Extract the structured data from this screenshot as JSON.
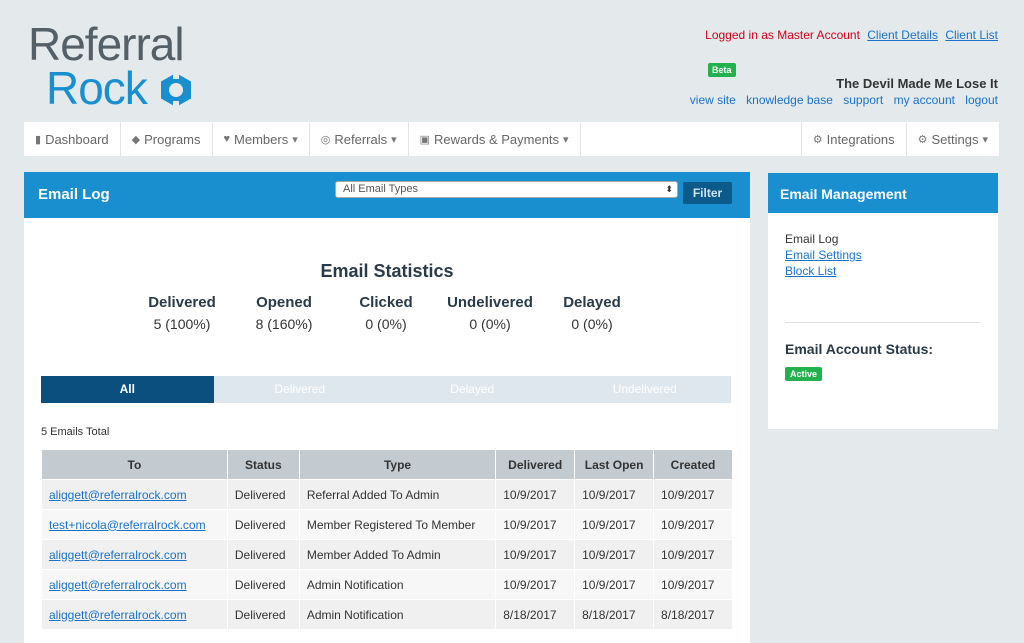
{
  "logo": {
    "line1": "Referral",
    "line2": "Rock"
  },
  "header": {
    "logged_in_text": "Logged in as Master Account",
    "client_details": "Client Details",
    "client_list": "Client List",
    "beta_badge": "Beta",
    "account_name": "The Devil Made Me Lose It",
    "links": [
      "view site",
      "knowledge base",
      "support",
      "my account",
      "logout"
    ]
  },
  "nav": {
    "dashboard": "Dashboard",
    "programs": "Programs",
    "members": "Members",
    "referrals": "Referrals",
    "rewards": "Rewards & Payments",
    "integrations": "Integrations",
    "settings": "Settings"
  },
  "email_log": {
    "title": "Email Log",
    "select_value": "All Email Types",
    "filter_label": "Filter",
    "stats_title": "Email Statistics",
    "stats": [
      {
        "label": "Delivered",
        "value": "5 (100%)"
      },
      {
        "label": "Opened",
        "value": "8 (160%)"
      },
      {
        "label": "Clicked",
        "value": "0 (0%)"
      },
      {
        "label": "Undelivered",
        "value": "0 (0%)"
      },
      {
        "label": "Delayed",
        "value": "0 (0%)"
      }
    ],
    "tabs": [
      "All",
      "Delivered",
      "Delayed",
      "Undelivered"
    ],
    "total_text": "5 Emails Total",
    "columns": [
      "To",
      "Status",
      "Type",
      "Delivered",
      "Last Open",
      "Created"
    ],
    "rows": [
      [
        "aliggett@referralrock.com",
        "Delivered",
        "Referral Added To Admin",
        "10/9/2017",
        "10/9/2017",
        "10/9/2017"
      ],
      [
        "test+nicola@referralrock.com",
        "Delivered",
        "Member Registered To Member",
        "10/9/2017",
        "10/9/2017",
        "10/9/2017"
      ],
      [
        "aliggett@referralrock.com",
        "Delivered",
        "Member Added To Admin",
        "10/9/2017",
        "10/9/2017",
        "10/9/2017"
      ],
      [
        "aliggett@referralrock.com",
        "Delivered",
        "Admin Notification",
        "10/9/2017",
        "10/9/2017",
        "10/9/2017"
      ],
      [
        "aliggett@referralrock.com",
        "Delivered",
        "Admin Notification",
        "8/18/2017",
        "8/18/2017",
        "8/18/2017"
      ]
    ]
  },
  "email_management": {
    "title": "Email Management",
    "current": "Email Log",
    "links": [
      "Email Settings",
      "Block List"
    ],
    "status_title": "Email Account Status:",
    "status_badge": "Active"
  },
  "colors": {
    "brand_blue": "#1a8fd0",
    "dark_blue": "#0b4f7e",
    "green": "#22b14c",
    "red": "#d0021b"
  }
}
